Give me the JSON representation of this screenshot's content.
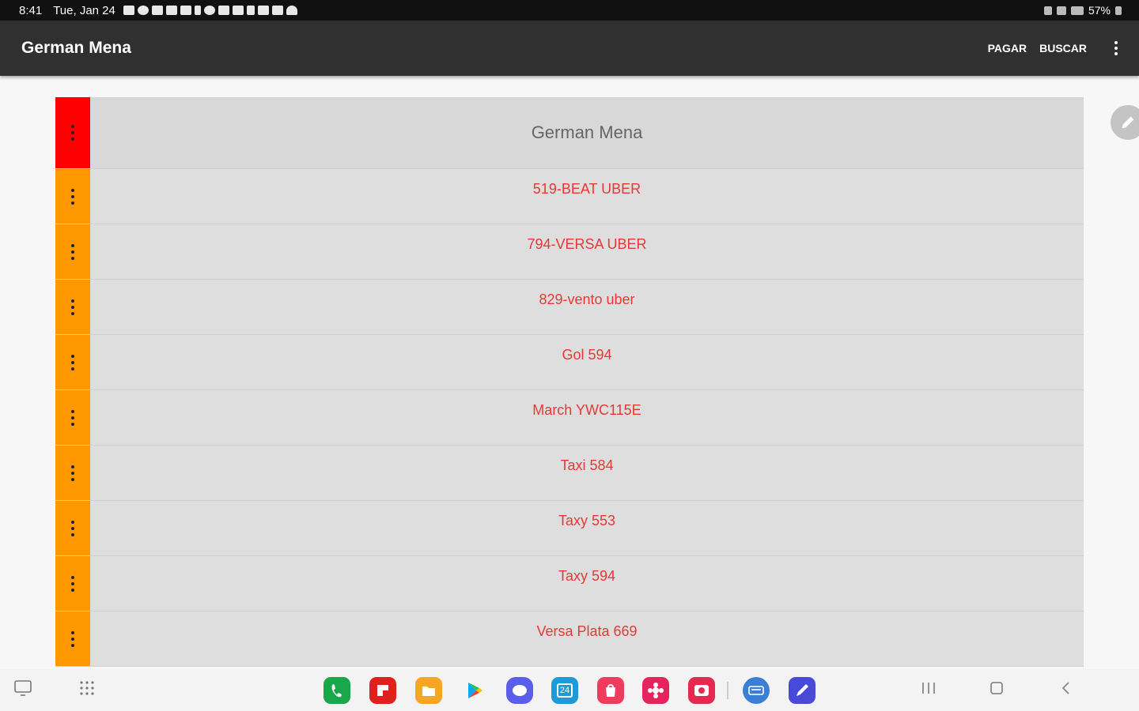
{
  "status_bar": {
    "time": "8:41",
    "date": "Tue, Jan 24",
    "battery": "57%"
  },
  "app_bar": {
    "title": "German Mena",
    "action_pay": "PAGAR",
    "action_search": "BUSCAR"
  },
  "list": {
    "header": "German Mena",
    "items": [
      "519-BEAT UBER",
      "794-VERSA  UBER",
      "829-vento uber",
      "Gol 594",
      "March YWC115E",
      "Taxi 584",
      "Taxy 553",
      "Taxy 594",
      "Versa  Plata 669"
    ]
  },
  "colors": {
    "header_handle": "#ff0000",
    "item_handle": "#ff9800",
    "item_text": "#e53935"
  },
  "taskbar": {
    "apps": [
      "phone-icon",
      "flipboard-icon",
      "my-files-icon",
      "play-store-icon",
      "messages-icon",
      "calendar-icon",
      "galaxy-store-icon",
      "bixby-icon",
      "screen-recorder-icon",
      "keyboard-app-icon",
      "pen-app-icon"
    ],
    "calendar_day": "24"
  }
}
